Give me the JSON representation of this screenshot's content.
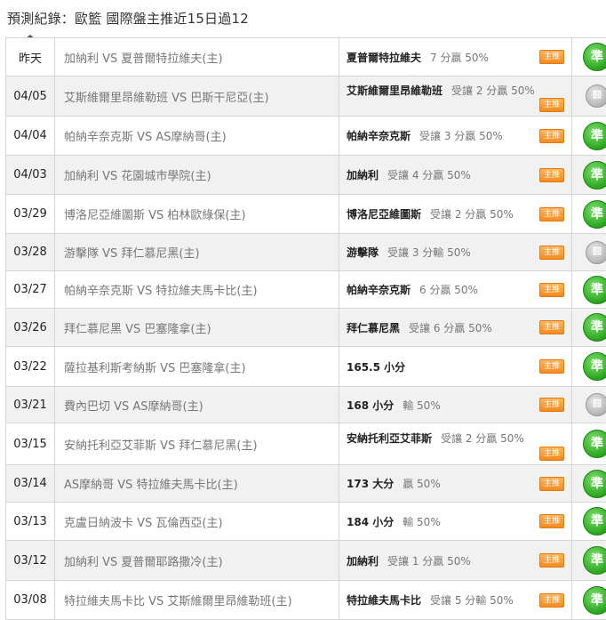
{
  "title": "預測紀錄：歐籃 國際盤主推近15日過12",
  "badge_label": "主推",
  "rows": [
    {
      "date": "昨天",
      "match": "加納利 VS 夏普爾特拉維夫(主)",
      "pick": "夏普爾特拉維夫",
      "detail": "7 分贏 50%",
      "result": "準",
      "status": "win",
      "two_line": false
    },
    {
      "date": "04/05",
      "match": "艾斯維爾里昂維勒班 VS 巴斯干尼亞(主)",
      "pick": "艾斯維爾里昂維勒班",
      "detail": "受讓 2 分贏 50%",
      "result": "囧",
      "status": "lose",
      "two_line": true
    },
    {
      "date": "04/04",
      "match": "帕納辛奈克斯 VS AS摩納哥(主)",
      "pick": "帕納辛奈克斯",
      "detail": "受讓 3 分贏 50%",
      "result": "準",
      "status": "win",
      "two_line": false
    },
    {
      "date": "04/03",
      "match": "加納利 VS 花園城市學院(主)",
      "pick": "加納利",
      "detail": "受讓 4 分贏 50%",
      "result": "準",
      "status": "win",
      "two_line": false
    },
    {
      "date": "03/29",
      "match": "博洛尼亞維圖斯 VS 柏林歐綠保(主)",
      "pick": "博洛尼亞維圖斯",
      "detail": "受讓 2 分贏 50%",
      "result": "準",
      "status": "win",
      "two_line": false
    },
    {
      "date": "03/28",
      "match": "游擊隊 VS 拜仁慕尼黑(主)",
      "pick": "游擊隊",
      "detail": "受讓 3 分輸 50%",
      "result": "囧",
      "status": "lose",
      "two_line": false
    },
    {
      "date": "03/27",
      "match": "帕納辛奈克斯 VS 特拉維夫馬卡比(主)",
      "pick": "帕納辛奈克斯",
      "detail": "6 分贏 50%",
      "result": "準",
      "status": "win",
      "two_line": false
    },
    {
      "date": "03/26",
      "match": "拜仁慕尼黑 VS 巴塞隆拿(主)",
      "pick": "拜仁慕尼黑",
      "detail": "受讓 6 分贏 50%",
      "result": "準",
      "status": "win",
      "two_line": false
    },
    {
      "date": "03/22",
      "match": "薩拉基利斯考納斯 VS 巴塞隆拿(主)",
      "pick": "165.5 小分",
      "detail": "",
      "result": "準",
      "status": "win",
      "two_line": false
    },
    {
      "date": "03/21",
      "match": "費內巴切 VS AS摩納哥(主)",
      "pick": "168 小分",
      "detail": "輸 50%",
      "result": "囧",
      "status": "lose",
      "two_line": false
    },
    {
      "date": "03/15",
      "match": "安納托利亞艾菲斯 VS 拜仁慕尼黑(主)",
      "pick": "安納托利亞艾菲斯",
      "detail": "受讓 2 分贏 50%",
      "result": "準",
      "status": "win",
      "two_line": true
    },
    {
      "date": "03/14",
      "match": "AS摩納哥 VS 特拉維夫馬卡比(主)",
      "pick": "173 大分",
      "detail": "贏 50%",
      "result": "準",
      "status": "win",
      "two_line": false
    },
    {
      "date": "03/13",
      "match": "克盧日納波卡 VS 瓦倫西亞(主)",
      "pick": "184 小分",
      "detail": "輸 50%",
      "result": "準",
      "status": "win",
      "two_line": false
    },
    {
      "date": "03/12",
      "match": "加納利 VS 夏普爾耶路撒冷(主)",
      "pick": "加納利",
      "detail": "受讓 1 分贏 50%",
      "result": "準",
      "status": "win",
      "two_line": false
    },
    {
      "date": "03/08",
      "match": "特拉維夫馬卡比 VS 艾斯維爾里昂維勒班(主)",
      "pick": "特拉維夫馬卡比",
      "detail": "受讓 5 分輸 50%",
      "result": "準",
      "status": "win",
      "two_line": false
    }
  ]
}
